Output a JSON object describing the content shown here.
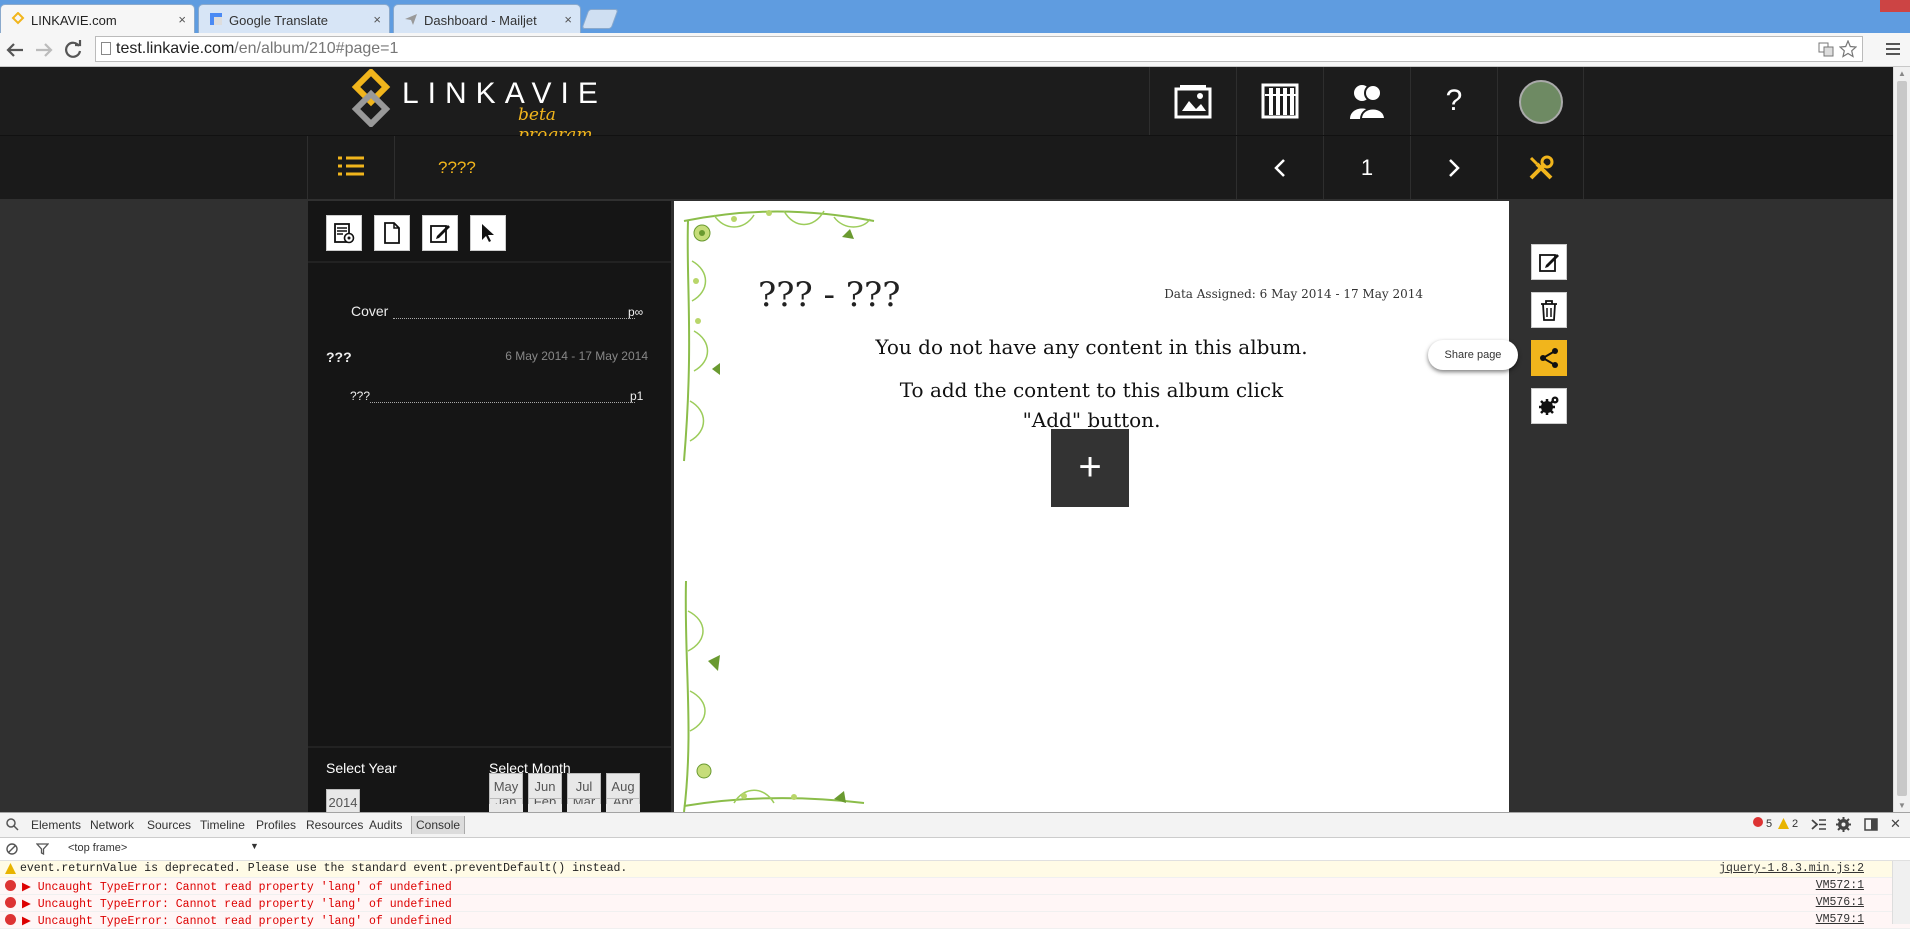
{
  "browser": {
    "tabs": [
      {
        "title": "LINKAVIE.com",
        "close": "×"
      },
      {
        "title": "Google Translate",
        "close": "×"
      },
      {
        "title": "Dashboard - Mailjet",
        "close": "×"
      }
    ],
    "url_host": "test.linkavie.com",
    "url_path": "/en/album/210#page=1"
  },
  "header": {
    "logo_text": "LINKAVIE",
    "logo_sub": "beta program",
    "help_label": "?",
    "album_name": "????",
    "page_number": "1",
    "prev": "‹",
    "next": "›"
  },
  "sidebar": {
    "toc": [
      {
        "label": "Cover",
        "page": "p∞"
      },
      {
        "label": "???",
        "range": "6 May 2014 - 17 May 2014"
      },
      {
        "label": "???",
        "page": "p1"
      }
    ],
    "select_year_label": "Select Year",
    "select_month_label": "Select Month",
    "years": [
      "2014"
    ],
    "months": [
      "Jan",
      "Feb",
      "Mar",
      "Apr",
      "May",
      "Jun",
      "Jul",
      "Aug"
    ]
  },
  "album": {
    "title": "??? - ???",
    "date_assigned": "Data Assigned: 6 May 2014 - 17 May 2014",
    "empty_msg1": "You do not have any content in this album.",
    "empty_msg2a": "To add the content to this album click",
    "empty_msg2b": "\"Add\" button.",
    "add_label": "+"
  },
  "right_tools": {
    "share_tooltip": "Share page"
  },
  "devtools": {
    "tabs": [
      "Elements",
      "Network",
      "Sources",
      "Timeline",
      "Profiles",
      "Resources",
      "Audits",
      "Console"
    ],
    "frame": "<top frame>",
    "error_count": "5",
    "warn_count": "2",
    "lines": [
      {
        "type": "warn",
        "text": "event.returnValue is deprecated. Please use the standard event.preventDefault() instead.",
        "src": "jquery-1.8.3.min.js:2"
      },
      {
        "type": "err",
        "text": "▶ Uncaught TypeError: Cannot read property 'lang' of undefined",
        "src": "VM572:1"
      },
      {
        "type": "err",
        "text": "▶ Uncaught TypeError: Cannot read property 'lang' of undefined",
        "src": "VM576:1"
      },
      {
        "type": "err",
        "text": "▶ Uncaught TypeError: Cannot read property 'lang' of undefined",
        "src": "VM579:1"
      }
    ]
  },
  "colors": {
    "accent": "#f1b51c",
    "header_bg": "#1c1c1c",
    "sidebar_bg": "#151515"
  }
}
